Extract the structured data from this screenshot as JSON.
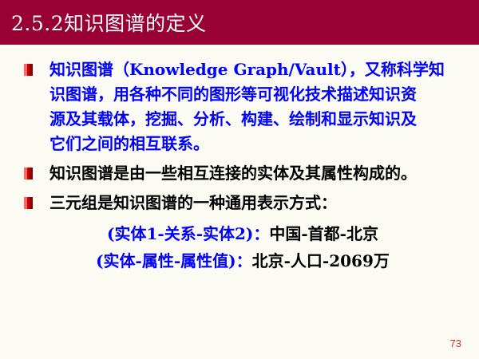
{
  "slide": {
    "title": "2.5.2知识图谱的定义",
    "bullets": [
      {
        "text": "知识图谱（Knowledge Graph/Vault），又称科学知\n识图谱，用各种不同的图形等可视化技术描述知识资\n源及其载体，挖掘、分析、构建、绘制和显示知识及\n它们之间的相互联系。",
        "color": "blue"
      },
      {
        "text": "知识图谱是由一些相互连接的实体及其属性构成的。",
        "color": "black"
      },
      {
        "text": "三元组是知识图谱的一种通用表示方式：",
        "color": "black"
      }
    ],
    "formulas": [
      {
        "pattern": "(实体1-关系-实体2)：",
        "example": "中国-首都-北京"
      },
      {
        "pattern": "(实体-属性-属性值)：",
        "example": "北京-人口-2069万"
      }
    ],
    "page_number": "73",
    "colors": {
      "title_bar": "#990033",
      "bullet_marker": "#cc0000",
      "accent_text": "#0000ff",
      "page_number": "#cc3333"
    },
    "icons": {
      "bullet": "square-bullet-icon"
    }
  }
}
